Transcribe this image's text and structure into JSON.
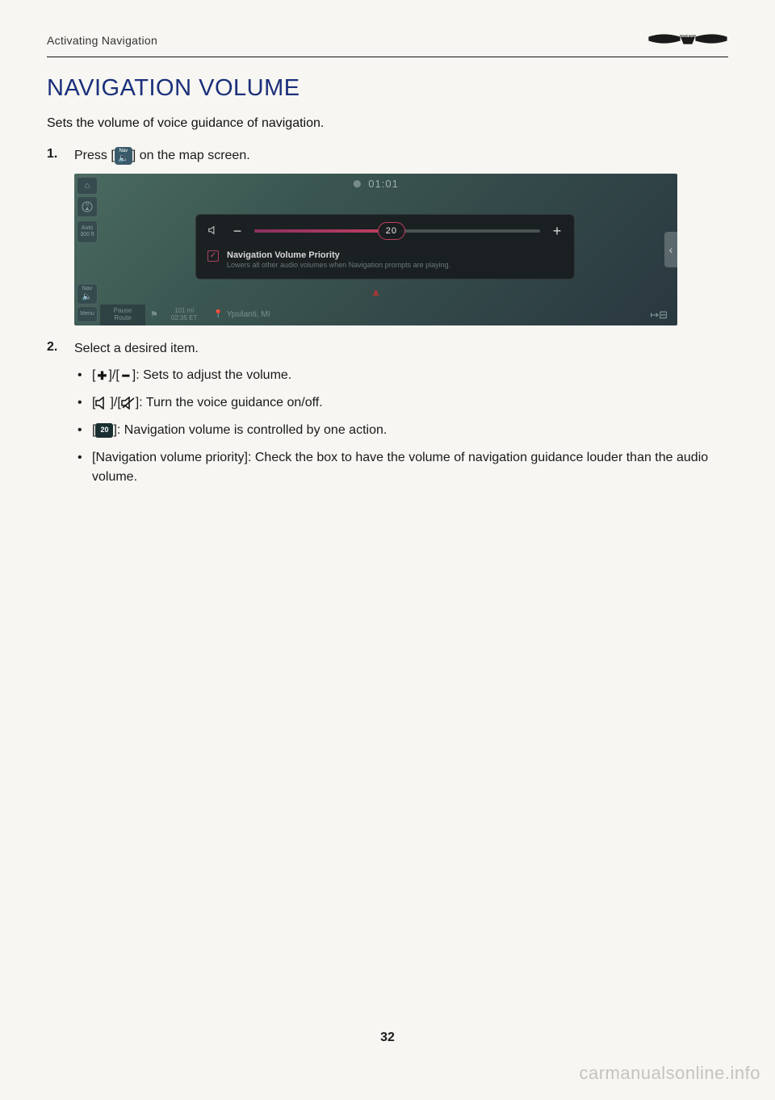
{
  "header": {
    "section": "Activating Navigation"
  },
  "title": "NAVIGATION VOLUME",
  "intro": "Sets the volume of voice guidance of navigation.",
  "step1": {
    "pre": "Press [",
    "icon_label": "Nav",
    "post": "] on the map screen."
  },
  "screenshot": {
    "clock": "01:01",
    "sidebar": {
      "auto_line1": "Auto",
      "auto_line2": "300 ft",
      "nav_label": "Nav",
      "menu_label": "Menu"
    },
    "popup": {
      "slider_value": "20",
      "priority_title": "Navigation Volume Priority",
      "priority_sub": "Lowers all other audio volumes when Navigation prompts are playing."
    },
    "bottom": {
      "pause_line1": "Pause",
      "pause_line2": "Route",
      "dist_line1": "101 mi",
      "dist_line2": "02:35 ET",
      "city": "Ypsilanti, MI"
    }
  },
  "step2": {
    "text": "Select a desired item.",
    "bullet1": {
      "pre": "[",
      "mid": "]/[",
      "post": "]: Sets to adjust the volume."
    },
    "bullet2": {
      "pre": "[",
      "mid": "]/[",
      "post": "]: Turn the voice guidance on/off."
    },
    "bullet3": {
      "pre": "[",
      "badge": "20",
      "post": "]: Navigation volume is controlled by one action."
    },
    "bullet4": "[Navigation volume priority]: Check the box to have the volume of navigation guidance louder than the audio volume."
  },
  "page_number": "32",
  "watermark": "carmanualsonline.info"
}
